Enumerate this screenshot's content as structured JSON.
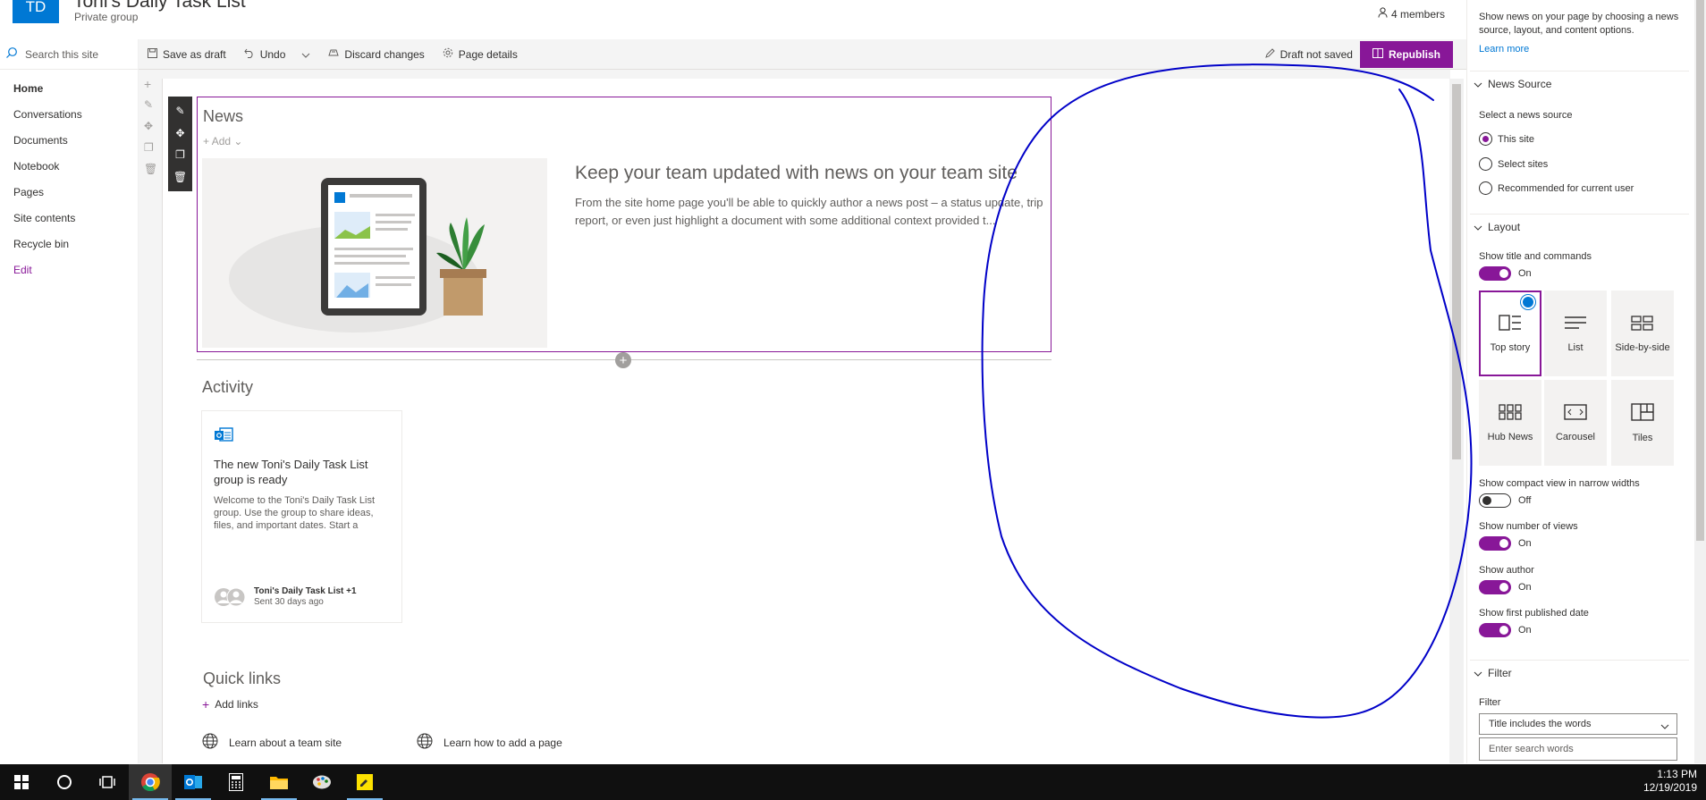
{
  "header": {
    "logo_text": "TD",
    "site_title": "Toni's Daily Task List",
    "site_subtitle": "Private group",
    "members": "4 members"
  },
  "leftnav": {
    "search_placeholder": "Search this site",
    "items": [
      {
        "label": "Home"
      },
      {
        "label": "Conversations"
      },
      {
        "label": "Documents"
      },
      {
        "label": "Notebook"
      },
      {
        "label": "Pages"
      },
      {
        "label": "Site contents"
      },
      {
        "label": "Recycle bin"
      },
      {
        "label": "Edit"
      }
    ]
  },
  "toolbar": {
    "save_draft": "Save as draft",
    "undo": "Undo",
    "discard": "Discard changes",
    "page_details": "Page details",
    "draft_status": "Draft not saved",
    "republish": "Republish"
  },
  "news": {
    "title": "News",
    "add": "Add",
    "headline": "Keep your team updated with news on your team site",
    "description": "From the site home page you'll be able to quickly author a news post – a status update, trip report, or even just highlight a document with some additional context provided t..."
  },
  "activity": {
    "title": "Activity",
    "card_heading": "The new Toni's Daily Task List group is ready",
    "card_body": "Welcome to the Toni's Daily Task List group. Use the group to share ideas, files, and important dates. Start a",
    "card_author": "Toni's Daily Task List +1",
    "card_time": "Sent 30 days ago"
  },
  "quick_links": {
    "title": "Quick links",
    "add": "Add links",
    "links": [
      "Learn about a team site",
      "Learn how to add a page"
    ]
  },
  "panel": {
    "intro": "Show news on your page by choosing a news source, layout, and content options.",
    "learn_more": "Learn more",
    "news_source_header": "News Source",
    "select_source_label": "Select a news source",
    "sources": [
      "This site",
      "Select sites",
      "Recommended for current user"
    ],
    "selected_source": "This site",
    "layout_header": "Layout",
    "show_title_label": "Show title and commands",
    "show_title_value": "On",
    "layouts": [
      "Top story",
      "List",
      "Side-by-side",
      "Hub News",
      "Carousel",
      "Tiles"
    ],
    "selected_layout": "Top story",
    "compact_label": "Show compact view in narrow widths",
    "compact_value": "Off",
    "views_label": "Show number of views",
    "views_value": "On",
    "author_label": "Show author",
    "author_value": "On",
    "published_label": "Show first published date",
    "published_value": "On",
    "filter_header": "Filter",
    "filter_label": "Filter",
    "filter_select": "Title includes the words",
    "search_words_placeholder": "Enter search words"
  },
  "taskbar": {
    "time": "1:13 PM",
    "date": "12/19/2019"
  },
  "colors": {
    "accent": "#881798",
    "brand_blue": "#0078d4",
    "annotation_ink": "#0000c8"
  }
}
